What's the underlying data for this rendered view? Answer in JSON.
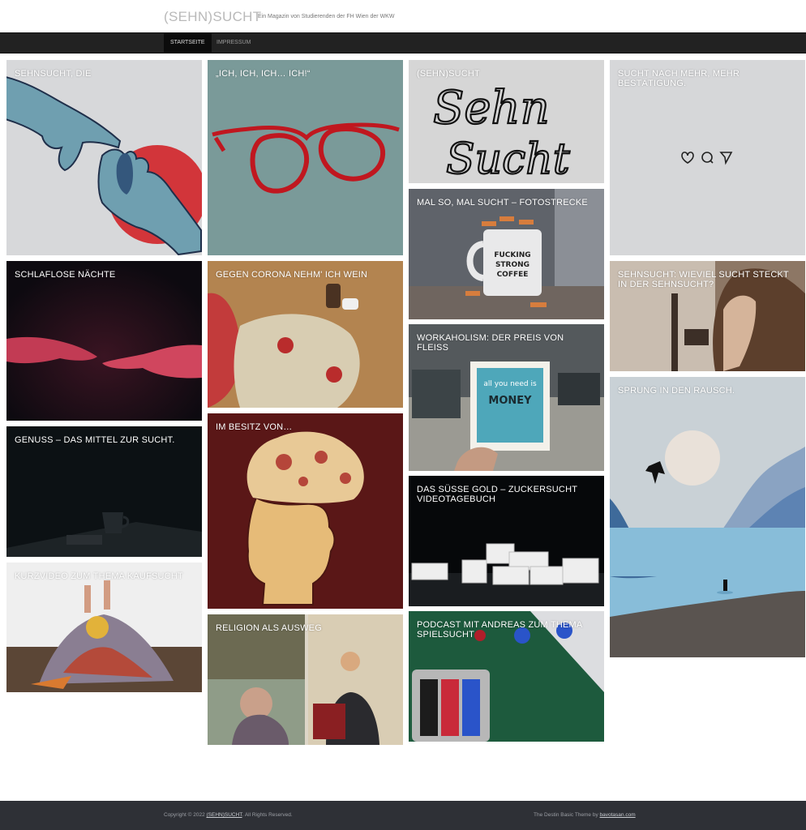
{
  "header": {
    "site_title": "(SEHN)SUCHT",
    "tagline": "Ein Magazin von Studierenden der FH Wien der WKW"
  },
  "nav": {
    "items": [
      {
        "label": "STARTSEITE",
        "active": true
      },
      {
        "label": "IMPRESSUM",
        "active": false
      }
    ]
  },
  "posts": [
    {
      "title": "SEHNSUCHT, DIE"
    },
    {
      "title": "SCHLAFLOSE NÄCHTE"
    },
    {
      "title": "GENUSS – DAS MITTEL ZUR SUCHT."
    },
    {
      "title": "KURZVIDEO ZUM THEMA KAUFSUCHT"
    },
    {
      "title": "„ICH, ICH, ICH… ICH!“"
    },
    {
      "title": "GEGEN CORONA NEHM' ICH WEIN"
    },
    {
      "title": "IM BESITZ VON…"
    },
    {
      "title": "RELIGION ALS AUSWEG"
    },
    {
      "title": "(SEHN)SUCHT"
    },
    {
      "title": "MAL SO, MAL SUCHT – FOTOSTRECKE"
    },
    {
      "title": "WORKAHOLISM: DER PREIS VON FLEISS"
    },
    {
      "title": "DAS SÜSSE GOLD – ZUCKERSUCHT VIDEOTAGEBUCH"
    },
    {
      "title": "PODCAST MIT ANDREAS ZUM THEMA SPIELSUCHT"
    },
    {
      "title": "SUCHT NACH MEHR, MEHR BESTÄTIGUNG."
    },
    {
      "title": "SEHNSUCHT: WIEVIEL SUCHT STECKT IN DER SEHNSUCHT?"
    },
    {
      "title": "SPRUNG IN DEN RAUSCH."
    }
  ],
  "artwork_text": {
    "handwriting_line1": "Sehn",
    "handwriting_line2": "Sucht",
    "mug_line1": "FUCKING",
    "mug_line2": "STRONG",
    "mug_line3": "COFFEE",
    "card_line1": "all you need is",
    "card_line2": "MONEY"
  },
  "footer": {
    "copyright_prefix": "Copyright © 2022 ",
    "copyright_link": "(SEHN)SUCHT",
    "copyright_suffix": ". All Rights Reserved.",
    "theme_prefix": "The Destin Basic Theme by ",
    "theme_link": "bavotasan.com"
  },
  "colors": {
    "nav_bg": "#222222",
    "footer_bg": "#2e3036",
    "glasses_bg": "#7a9a99",
    "glasses_red": "#c0171f",
    "sun_red": "#d2353a",
    "head_bg": "#5a1717"
  },
  "icons": [
    "heart-icon",
    "comment-icon",
    "share-icon"
  ]
}
